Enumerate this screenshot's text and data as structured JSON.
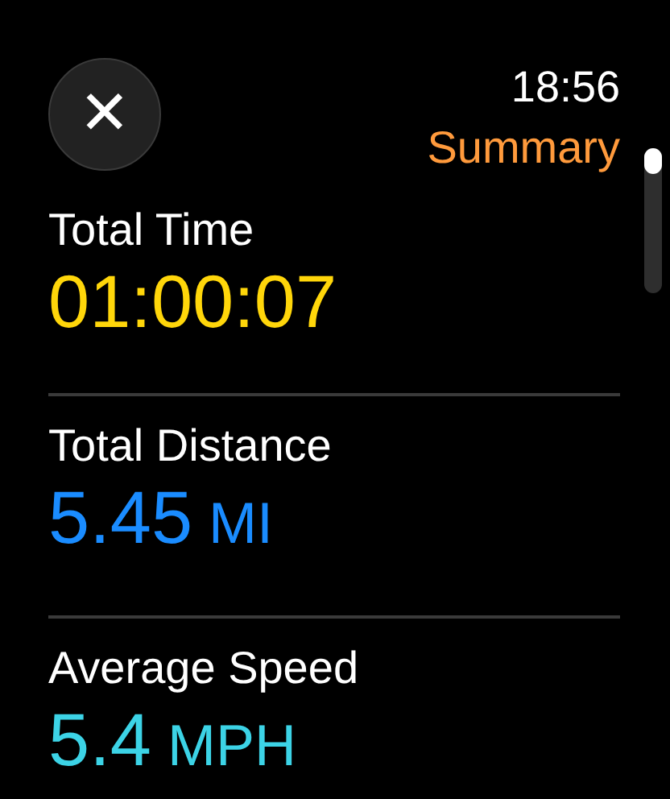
{
  "header": {
    "close_label": "✕",
    "time": "18:56",
    "title": "Summary"
  },
  "metrics": [
    {
      "label": "Total Time",
      "value": "01:00:07",
      "color": "#ffd60a"
    },
    {
      "label": "Total Distance",
      "value": "5.45",
      "unit": "MI",
      "color": "#1a8cff"
    },
    {
      "label": "Average Speed",
      "value": "5.4",
      "unit": "MPH",
      "color": "#3cd3e6"
    }
  ]
}
